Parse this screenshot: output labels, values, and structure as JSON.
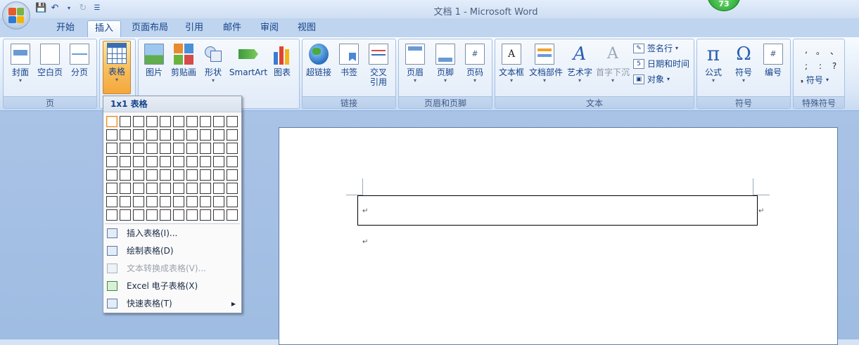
{
  "window": {
    "title": "文档 1 - Microsoft Word",
    "badge": "73"
  },
  "qat": {
    "save_icon": "save-icon",
    "undo_icon": "undo-icon",
    "redo_icon": "redo-icon",
    "customize_icon": "customize-icon"
  },
  "tabs": [
    "开始",
    "插入",
    "页面布局",
    "引用",
    "邮件",
    "审阅",
    "视图"
  ],
  "active_tab": "插入",
  "ribbon": {
    "groups": {
      "pages": {
        "label": "页",
        "buttons": [
          "封面",
          "空白页",
          "分页"
        ]
      },
      "tables": {
        "button": "表格"
      },
      "illustrations": {
        "buttons": [
          "图片",
          "剪贴画",
          "形状",
          "SmartArt",
          "图表"
        ]
      },
      "links": {
        "label": "链接",
        "buttons": [
          "超链接",
          "书签",
          "交叉",
          "引用"
        ]
      },
      "header_footer": {
        "label": "页眉和页脚",
        "buttons": [
          "页眉",
          "页脚",
          "页码"
        ]
      },
      "text": {
        "label": "文本",
        "buttons": [
          "文本框",
          "文档部件",
          "艺术字",
          "首字下沉"
        ],
        "small": [
          "签名行",
          "日期和时间",
          "对象"
        ]
      },
      "symbols": {
        "label": "符号",
        "buttons": [
          "公式",
          "符号",
          "编号"
        ]
      },
      "special": {
        "label": "特殊符号",
        "chars": [
          ",",
          "。",
          "、",
          ";",
          ":",
          "?"
        ],
        "more": "符号"
      }
    }
  },
  "dropdown": {
    "header": "1x1 表格",
    "grid_cols": 10,
    "grid_rows": 8,
    "items": [
      {
        "label": "插入表格(I)...",
        "disabled": false
      },
      {
        "label": "绘制表格(D)",
        "disabled": false
      },
      {
        "label": "文本转换成表格(V)...",
        "disabled": true
      },
      {
        "label": "Excel 电子表格(X)",
        "disabled": false
      },
      {
        "label": "快速表格(T)",
        "disabled": false,
        "submenu": true
      }
    ]
  },
  "document": {
    "pilcrow": "↵"
  },
  "colors": {
    "accent": "#15428b",
    "ribbon_bg": "#dce8f7",
    "selected": "#f8c060"
  }
}
